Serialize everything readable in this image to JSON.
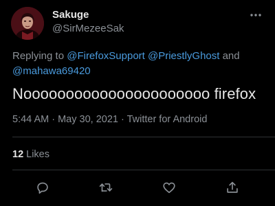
{
  "author": {
    "display_name": "Sakuge",
    "handle": "@SirMezeeSak",
    "avatar_icon": "avatar-image"
  },
  "reply": {
    "prefix": "Replying to ",
    "mention_1": "@FirefoxSupport",
    "mention_2": "@PriestlyGhost",
    "joiner": " and",
    "mention_3": "@mahawa69420"
  },
  "tweet": {
    "text": "Noooooooooooooooooooooo firefox"
  },
  "meta": {
    "text": "5:44 AM · May 30, 2021 · Twitter for Android"
  },
  "stats": {
    "likes_count": "12",
    "likes_label": "Likes"
  },
  "actions": {
    "reply_icon": "reply-icon",
    "retweet_icon": "retweet-icon",
    "like_icon": "heart-icon",
    "share_icon": "share-icon",
    "more_icon": "more-icon"
  },
  "colors": {
    "background": "#000000",
    "link": "#4a9bde",
    "secondary_text": "#8b9096",
    "primary_text": "#e7e7e7"
  }
}
